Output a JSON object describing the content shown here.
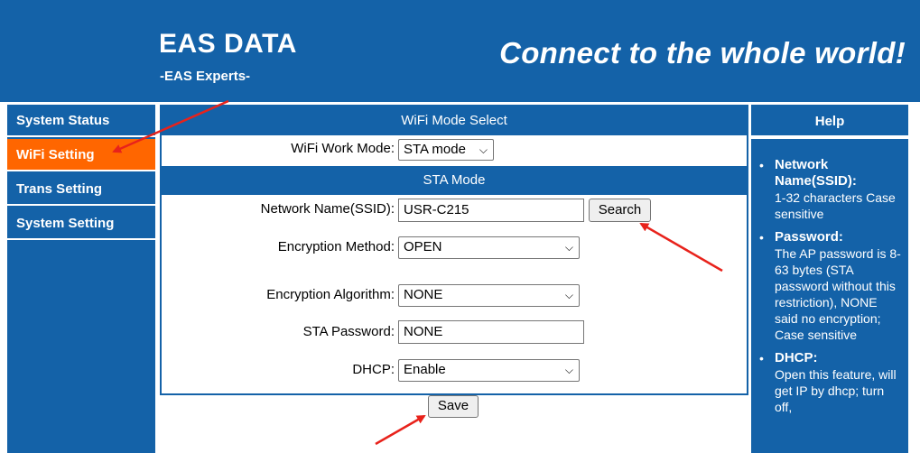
{
  "header": {
    "title": "EAS DATA",
    "subtitle": "-EAS Experts-",
    "slogan": "Connect to the whole world!"
  },
  "sidebar": {
    "items": [
      {
        "label": "System Status",
        "active": false
      },
      {
        "label": "WiFi Setting",
        "active": true
      },
      {
        "label": "Trans Setting",
        "active": false
      },
      {
        "label": "System Setting",
        "active": false
      }
    ]
  },
  "main": {
    "mode_section_title": "WiFi Mode Select",
    "work_mode_label": "WiFi Work Mode:",
    "work_mode_value": "STA mode",
    "sta_section_title": "STA Mode",
    "ssid_label": "Network Name(SSID):",
    "ssid_value": "USR-C215",
    "search_label": "Search",
    "encryption_method_label": "Encryption Method:",
    "encryption_method_value": "OPEN",
    "encryption_algorithm_label": "Encryption Algorithm:",
    "encryption_algorithm_value": "NONE",
    "sta_password_label": "STA Password:",
    "sta_password_value": "NONE",
    "dhcp_label": "DHCP:",
    "dhcp_value": "Enable",
    "save_label": "Save"
  },
  "help": {
    "title": "Help",
    "items": [
      {
        "term": "Network Name(SSID):",
        "desc": "1-32 characters Case sensitive"
      },
      {
        "term": "Password:",
        "desc": "The AP password is 8-63 bytes (STA password without this restriction), NONE said no encryption; Case sensitive"
      },
      {
        "term": "DHCP:",
        "desc": "Open this feature, will get IP by dhcp; turn off,"
      }
    ]
  },
  "colors": {
    "primary": "#1462a8",
    "active": "#ff6600",
    "annotation": "#e8221b"
  }
}
